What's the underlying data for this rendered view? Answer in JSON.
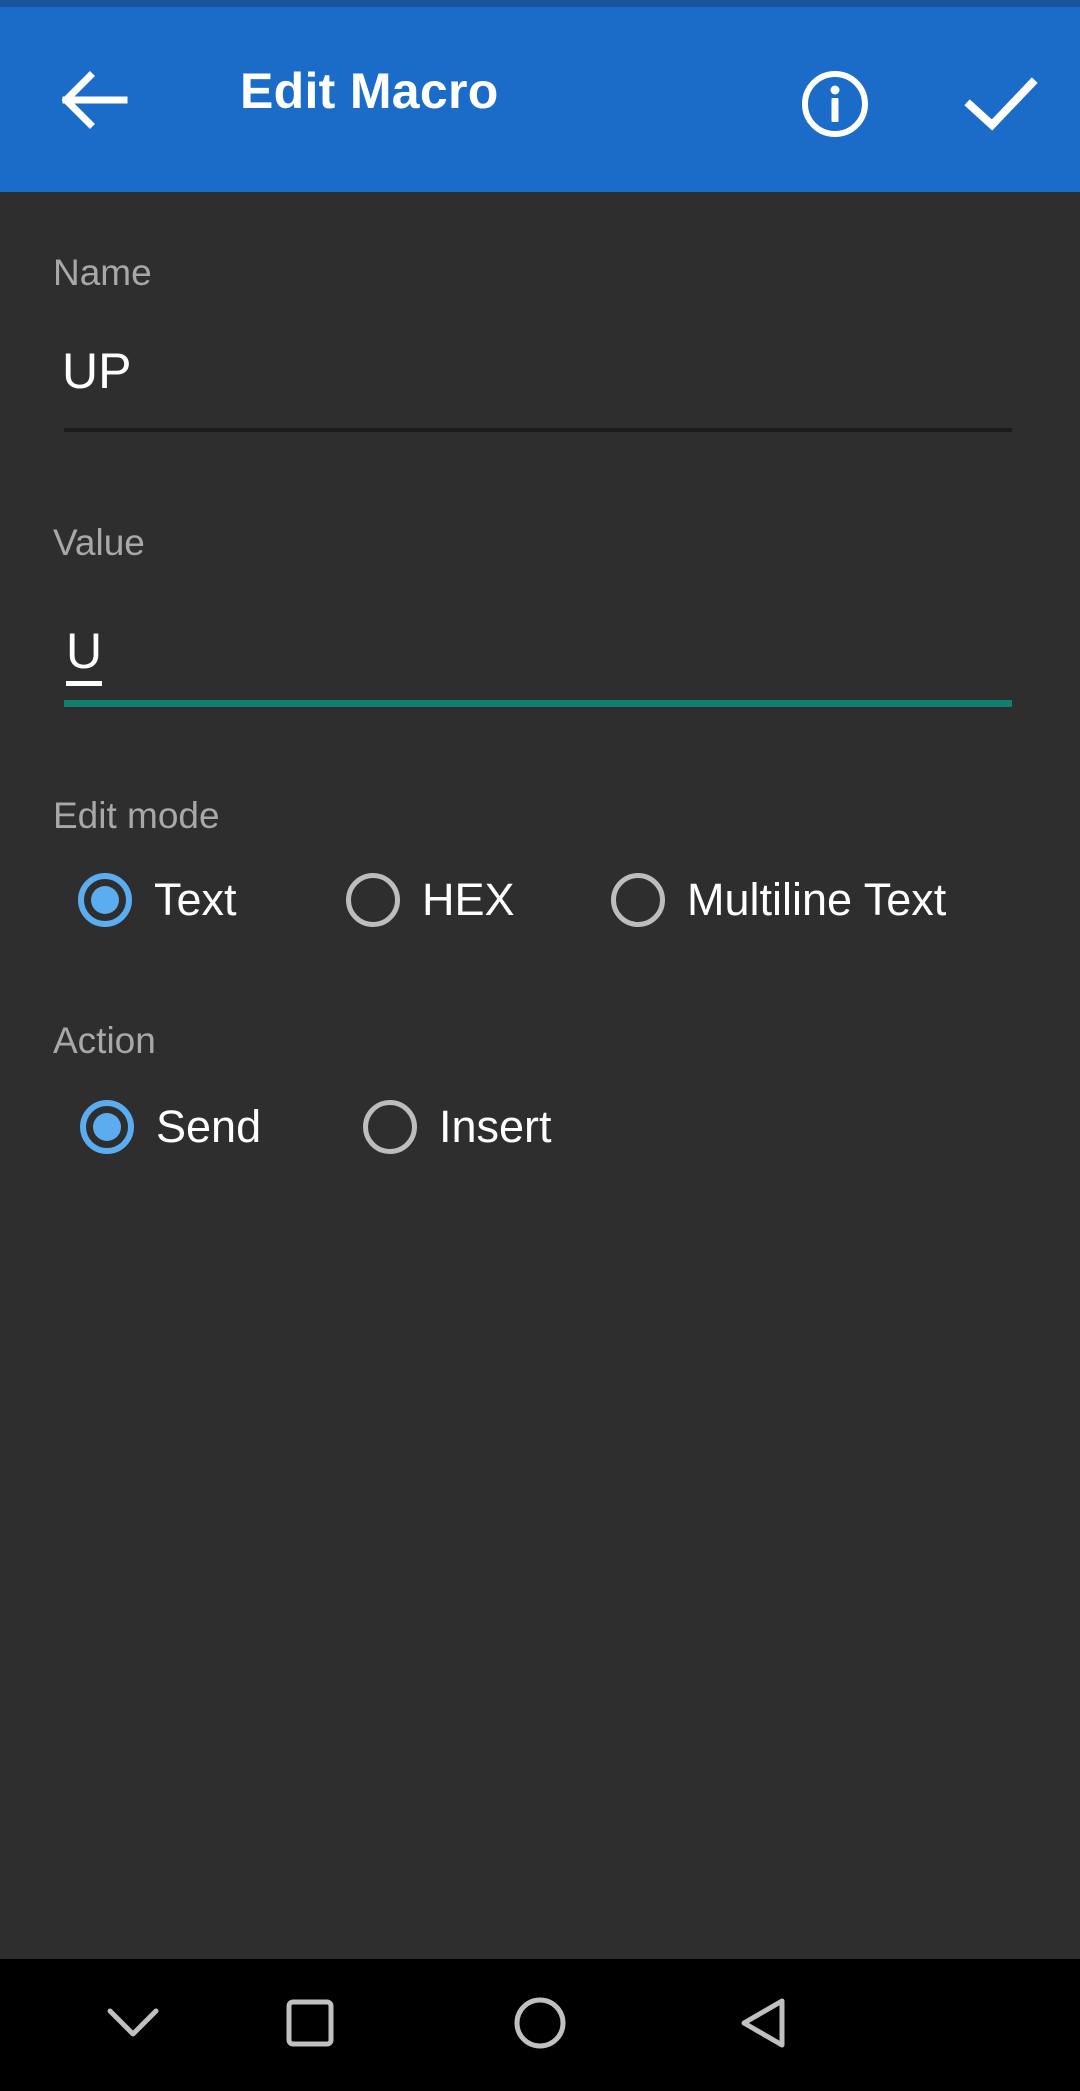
{
  "appbar": {
    "title": "Edit Macro",
    "back_icon": "arrow-left-icon",
    "info_icon": "info-circle-icon",
    "confirm_icon": "check-icon",
    "background_color": "#1a6cc8"
  },
  "form": {
    "name": {
      "label": "Name",
      "value": "UP",
      "placeholder": "",
      "underline_color": "#1b1b1b"
    },
    "value": {
      "label": "Value",
      "value": "U",
      "placeholder": "",
      "underline_color": "#0f8070",
      "focused": "true"
    }
  },
  "edit_mode": {
    "label": "Edit mode",
    "selected": "Text",
    "options": [
      {
        "label": "Text",
        "selected": true
      },
      {
        "label": "HEX",
        "selected": false
      },
      {
        "label": "Multiline Text",
        "selected": false
      }
    ]
  },
  "action": {
    "label": "Action",
    "selected": "Send",
    "options": [
      {
        "label": "Send",
        "selected": true
      },
      {
        "label": "Insert",
        "selected": false
      }
    ]
  },
  "navbar": {
    "buttons": [
      {
        "icon": "chevron-down-icon",
        "name": "hide-keyboard"
      },
      {
        "icon": "square-icon",
        "name": "recents"
      },
      {
        "icon": "circle-icon",
        "name": "home"
      },
      {
        "icon": "triangle-left-icon",
        "name": "back"
      }
    ]
  },
  "colors": {
    "accent_blue": "#5badf0",
    "appbar_blue": "#1a6cc8",
    "focus_teal": "#0f8070",
    "background": "#2e2e2e",
    "label_gray": "#a8a8a8",
    "navbar_icon": "#c0c0c0"
  }
}
